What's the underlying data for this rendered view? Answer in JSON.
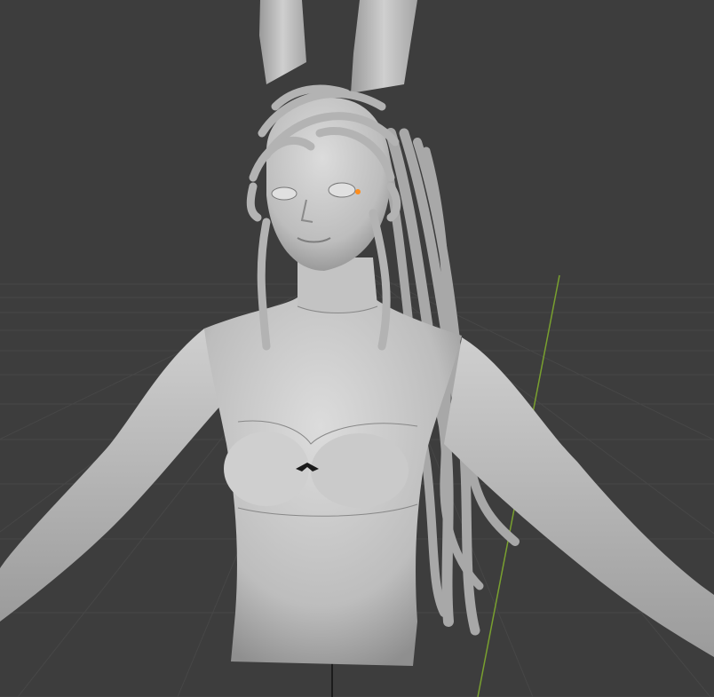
{
  "viewport": {
    "view": "3D viewport",
    "background_color": "#3d3d3d",
    "grid_line_color": "#474747",
    "y_axis_color": "#79a02f",
    "model_color": "#c9c9c9",
    "selection_color": "#ff8c1a"
  },
  "scene_objects": [
    {
      "label": "character-bust-model",
      "kind": "mesh"
    },
    {
      "label": "bunny-ear-left",
      "kind": "mesh"
    },
    {
      "label": "bunny-ear-right",
      "kind": "mesh"
    },
    {
      "label": "hair-strands",
      "kind": "mesh"
    },
    {
      "label": "bow-tie",
      "kind": "mesh"
    },
    {
      "label": "selected-vertex",
      "kind": "point"
    }
  ]
}
